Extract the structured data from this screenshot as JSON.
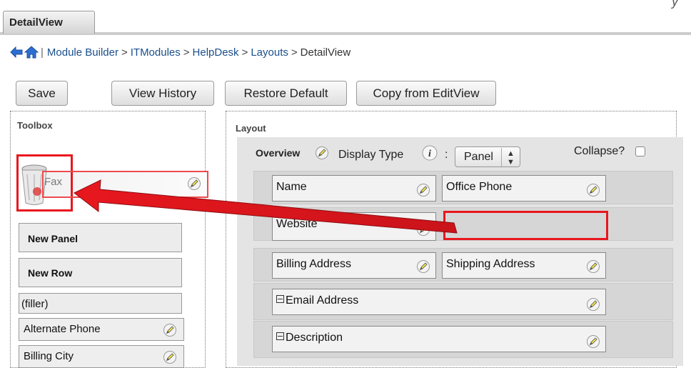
{
  "tab": {
    "label": "DetailView"
  },
  "corner_glyph": "y",
  "breadcrumb": {
    "separator": ">",
    "bar": "|",
    "items": [
      "Module Builder",
      "ITModules",
      "HelpDesk",
      "Layouts"
    ],
    "current": "DetailView"
  },
  "toolbar": {
    "save": "Save",
    "view_history": "View History",
    "restore_default": "Restore Default",
    "copy_from_editview": "Copy from EditView"
  },
  "toolbox": {
    "title": "Toolbox",
    "dragged_field": "Fax",
    "new_panel": "New Panel",
    "new_row": "New Row",
    "filler": "(filler)",
    "fields": [
      "Alternate Phone",
      "Billing City"
    ]
  },
  "layout": {
    "title": "Layout",
    "panel_name": "Overview",
    "display_type_label": "Display Type",
    "colon": ":",
    "display_type_value": "Panel",
    "collapse_label": "Collapse?",
    "collapse_checked": false,
    "rows": [
      {
        "left": "Name",
        "right": "Office Phone"
      },
      {
        "left": "Website",
        "right": ""
      },
      {
        "left": "Billing Address",
        "right": "Shipping Address"
      },
      {
        "full": "Email Address"
      },
      {
        "full": "Description"
      }
    ]
  },
  "colors": {
    "link": "#1a4f8b",
    "highlight_red": "#e8171e",
    "panel_bg": "#e4e4e4",
    "pencil_yellow": "#f2e34b"
  },
  "icons": {
    "back": "back-arrow-icon",
    "home": "home-icon",
    "trash": "trash-icon",
    "edit": "pencil-icon",
    "info": "info-icon",
    "select_arrows": "updown-arrow-icon",
    "collapse_toggle": "minus-icon"
  }
}
